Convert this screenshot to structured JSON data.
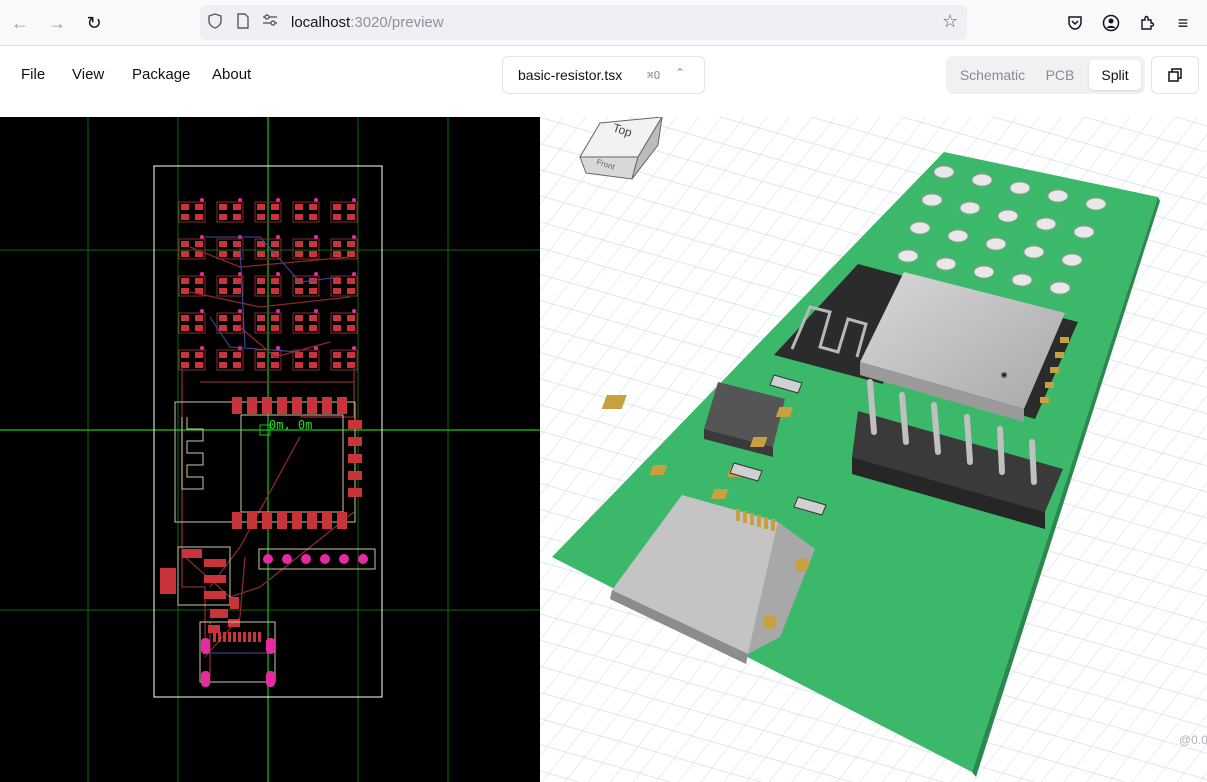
{
  "browser": {
    "url_host": "localhost",
    "url_rest": ":3020/preview",
    "icons": {
      "back": "back-arrow-icon",
      "forward": "forward-arrow-icon",
      "reload": "reload-icon",
      "shield": "shield-icon",
      "page": "page-icon",
      "permissions": "permissions-icon",
      "bookmark": "star-icon",
      "pocket": "pocket-icon",
      "account": "account-icon",
      "extensions": "extensions-icon",
      "menu": "hamburger-menu-icon"
    }
  },
  "menu": {
    "items": [
      "File",
      "View",
      "Package",
      "About"
    ]
  },
  "file_selector": {
    "name": "basic-resistor.tsx",
    "shortcut": "⌘O"
  },
  "view_toggle": {
    "options": [
      "Schematic",
      "PCB",
      "Split"
    ],
    "active": "Split"
  },
  "pcb": {
    "component_label": "0m, 0m",
    "colors": {
      "background": "#000000",
      "grid": "#0a6b0a",
      "copper": "#c8343a",
      "via": "#e62ba0",
      "silkscreen": "#e8e8c8",
      "board_outline": "#ffffff",
      "label": "#22dd22"
    }
  },
  "view3d": {
    "orientation_cube": {
      "top": "Top",
      "front": "Front"
    },
    "watermark": "@0.0",
    "colors": {
      "board": "#3cb86a",
      "grid": "#c9d6e3",
      "module": "#c8c8c8",
      "header": "#3a3a3a"
    }
  }
}
